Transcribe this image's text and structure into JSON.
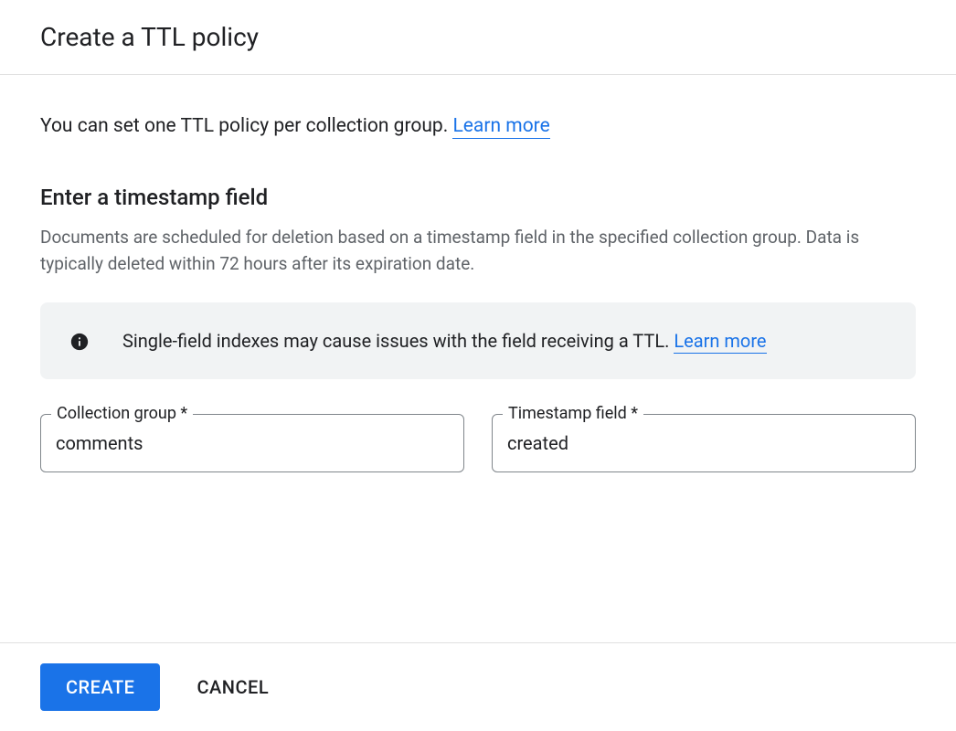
{
  "header": {
    "title": "Create a TTL policy"
  },
  "intro": {
    "text": "You can set one TTL policy per collection group. ",
    "link": "Learn more"
  },
  "section": {
    "title": "Enter a timestamp field",
    "description": "Documents are scheduled for deletion based on a timestamp field in the specified collection group. Data is typically deleted within 72 hours after its expiration date."
  },
  "infobox": {
    "text": "Single-field indexes may cause issues with the field receiving a TTL. ",
    "link": "Learn more"
  },
  "fields": {
    "collection_group": {
      "label": "Collection group *",
      "value": "comments"
    },
    "timestamp_field": {
      "label": "Timestamp field *",
      "value": "created"
    }
  },
  "footer": {
    "create": "CREATE",
    "cancel": "CANCEL"
  }
}
